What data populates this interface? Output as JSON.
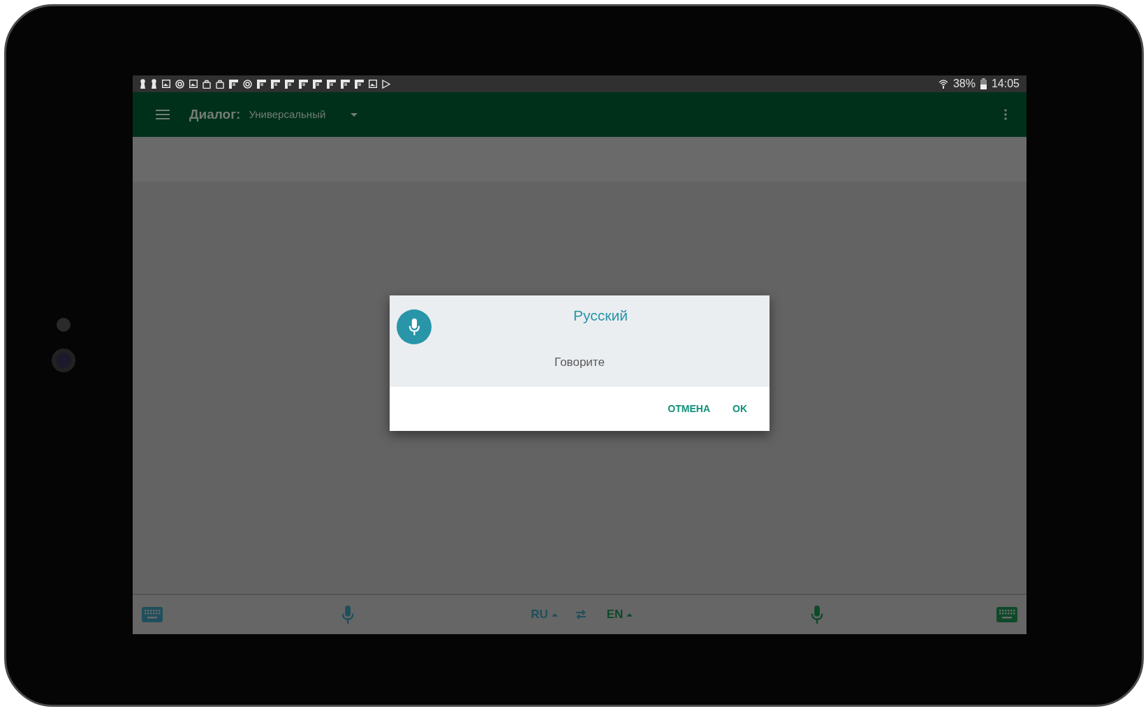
{
  "status_bar": {
    "battery": "38%",
    "time": "14:05"
  },
  "toolbar": {
    "label": "Диалог:",
    "dialog_type": "Универсальный"
  },
  "dialog": {
    "title": "Русский",
    "message": "Говорите",
    "buttons": [
      "ОТМЕНА",
      "OK"
    ]
  },
  "bottom_bar": {
    "source_language": "RU",
    "target_language": "EN"
  }
}
